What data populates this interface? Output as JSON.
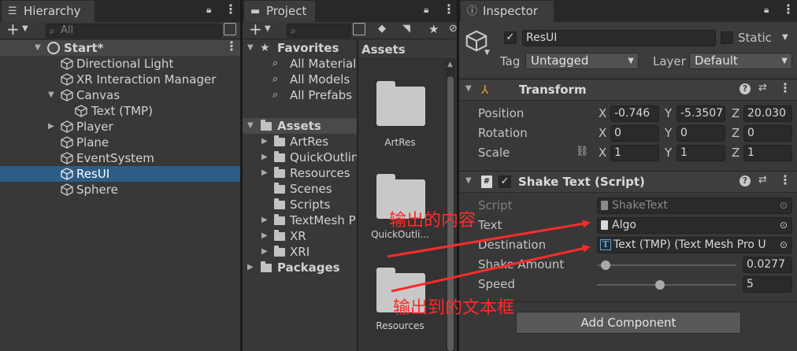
{
  "hierarchy": {
    "tab_label": "Hierarchy",
    "add_label": "+",
    "search_placeholder": "All",
    "scene_name": "Start*",
    "items": [
      {
        "label": "Directional Light"
      },
      {
        "label": "XR Interaction Manager"
      },
      {
        "label": "Canvas"
      },
      {
        "label": "Text (TMP)"
      },
      {
        "label": "Player"
      },
      {
        "label": "Plane"
      },
      {
        "label": "EventSystem"
      },
      {
        "label": "ResUI"
      },
      {
        "label": "Sphere"
      }
    ]
  },
  "project": {
    "tab_label": "Project",
    "add_label": "+",
    "favorites_label": "Favorites",
    "favorites": [
      "All Materials",
      "All Models",
      "All Prefabs"
    ],
    "assets_label": "Assets",
    "asset_folders": [
      "ArtRes",
      "QuickOutlin",
      "Resources",
      "Scenes",
      "Scripts",
      "TextMesh P",
      "XR",
      "XRI"
    ],
    "packages_label": "Packages",
    "grid_header": "Assets",
    "grid_items": [
      "ArtRes",
      "QuickOutli...",
      "Resources"
    ]
  },
  "inspector": {
    "tab_label": "Inspector",
    "object_name": "ResUI",
    "static_label": "Static",
    "tag_label": "Tag",
    "tag_value": "Untagged",
    "layer_label": "Layer",
    "layer_value": "Default",
    "transform": {
      "title": "Transform",
      "position_label": "Position",
      "rotation_label": "Rotation",
      "scale_label": "Scale",
      "position": {
        "x": "-0.746",
        "y": "-5.3507",
        "z": "20.030"
      },
      "rotation": {
        "x": "0",
        "y": "0",
        "z": "0"
      },
      "scale": {
        "x": "1",
        "y": "1",
        "z": "1"
      },
      "axis": {
        "x": "X",
        "y": "Y",
        "z": "Z"
      }
    },
    "shake_text": {
      "title": "Shake Text (Script)",
      "script_label": "Script",
      "script_value": "ShakeText",
      "text_label": "Text",
      "text_value": "Algo",
      "destination_label": "Destination",
      "destination_value": "Text (TMP) (Text Mesh Pro U",
      "shake_amount_label": "Shake Amount",
      "shake_amount_value": "0.0277",
      "shake_amount_fraction": 0.03,
      "speed_label": "Speed",
      "speed_value": "5",
      "speed_fraction": 0.45
    },
    "add_component_label": "Add Component"
  },
  "annotations": {
    "text_note": "输出的内容",
    "destination_note": "输出到的文本框",
    "color": "#ff2b2b"
  },
  "colors": {
    "selection": "#2c5d87",
    "panel": "#383838",
    "tabbar": "#282828"
  }
}
